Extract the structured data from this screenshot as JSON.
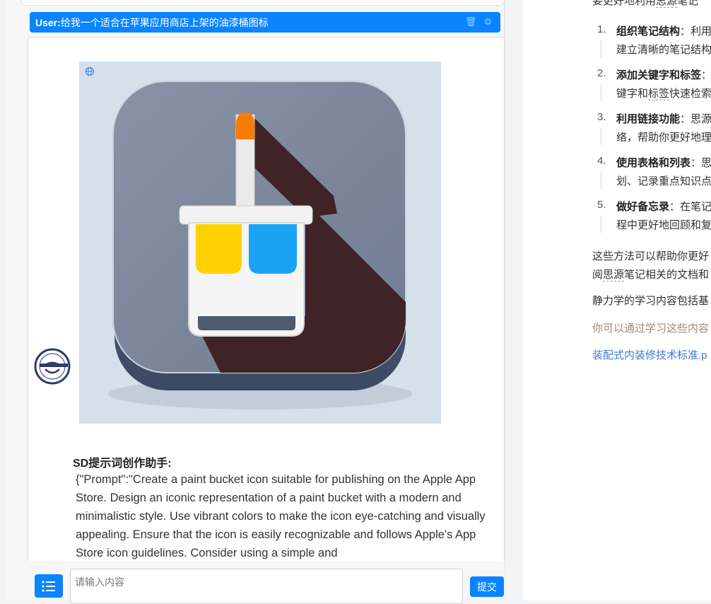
{
  "chat": {
    "user_label": "User:",
    "user_message": "给我一个适合在苹果应用商店上架的油漆桶图标",
    "assistant_name": "SD提示词创作助手:",
    "assistant_text": "{\"Prompt\":\"Create a paint bucket icon suitable for publishing on the Apple App Store. Design an iconic representation of a paint bucket with a modern and minimalistic style. Use vibrant colors to make the icon eye-catching and visually appealing. Ensure that the icon is easily recognizable and follows Apple's App Store icon guidelines. Consider using a simple and",
    "input_placeholder": "请输入内容",
    "submit_label": "提交"
  },
  "doc": {
    "top_line_a": "要更好地利用",
    "top_line_b": "思源",
    "top_line_c": "笔记",
    "items": [
      {
        "num": "1.",
        "bold": "组织笔记结构",
        "rest": "：利用",
        "line2": "建立清晰的笔记结构"
      },
      {
        "num": "2.",
        "bold": "添加关键字和标签",
        "rest": "：",
        "line2a": "键字和",
        "line2b": "标签",
        "line2c": "快速检索"
      },
      {
        "num": "3.",
        "bold": "利用链接功能",
        "rest": "：思源",
        "line2": "络，帮助你更好地理"
      },
      {
        "num": "4.",
        "bold": "使用表格和列表",
        "rest": "：思",
        "line2": "划、记录重点知识点"
      },
      {
        "num": "5.",
        "bold": "做好备忘录",
        "rest": "：在笔记",
        "line2": "程中更好地回顾和复"
      }
    ],
    "para1_line1": "这些方法可以帮助你更好",
    "para1_line2a": "阅",
    "para1_line2b": "思源",
    "para1_line2c": "笔记相关的文档和",
    "para2": "静力学的学习内容包括基",
    "para3": "你可以通过学习这些内容",
    "para4": "装配式内装修技术标准.p"
  },
  "colors": {
    "accent": "#0a84ff",
    "muted_text": "#a08a7a",
    "link": "#3a7bd5"
  }
}
